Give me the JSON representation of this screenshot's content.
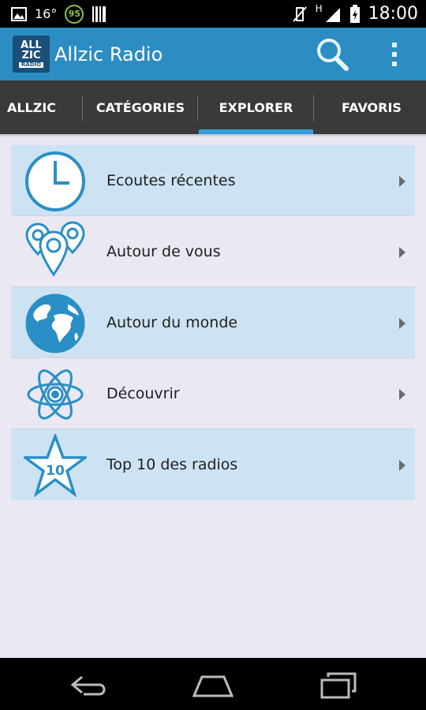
{
  "status_bar": {
    "temperature": "16°",
    "badge": "95",
    "network": "H",
    "time": "18:00"
  },
  "app": {
    "title": "Allzic Radio",
    "logo_line1": "ALL",
    "logo_line2": "ZIC",
    "logo_line3": "RADIO"
  },
  "tabs": [
    {
      "label": "ALLZIC"
    },
    {
      "label": "CATÉGORIES"
    },
    {
      "label": "EXPLORER",
      "selected": true
    },
    {
      "label": "FAVORIS"
    }
  ],
  "explore_items": [
    {
      "label": "Ecoutes récentes",
      "icon": "clock-icon"
    },
    {
      "label": "Autour de vous",
      "icon": "location-pins-icon"
    },
    {
      "label": "Autour du monde",
      "icon": "globe-icon"
    },
    {
      "label": "Découvrir",
      "icon": "atom-icon"
    },
    {
      "label": "Top 10 des radios",
      "icon": "star-10-icon",
      "icon_text": "10"
    }
  ],
  "colors": {
    "accent": "#2b8dc2",
    "icon_blue": "#2a8fc6",
    "tab_indicator": "#2f9fd8",
    "row_shaded": "#cde3f3",
    "background": "#e9e8f3"
  },
  "nav": [
    "back-icon",
    "home-icon",
    "recent-apps-icon"
  ]
}
